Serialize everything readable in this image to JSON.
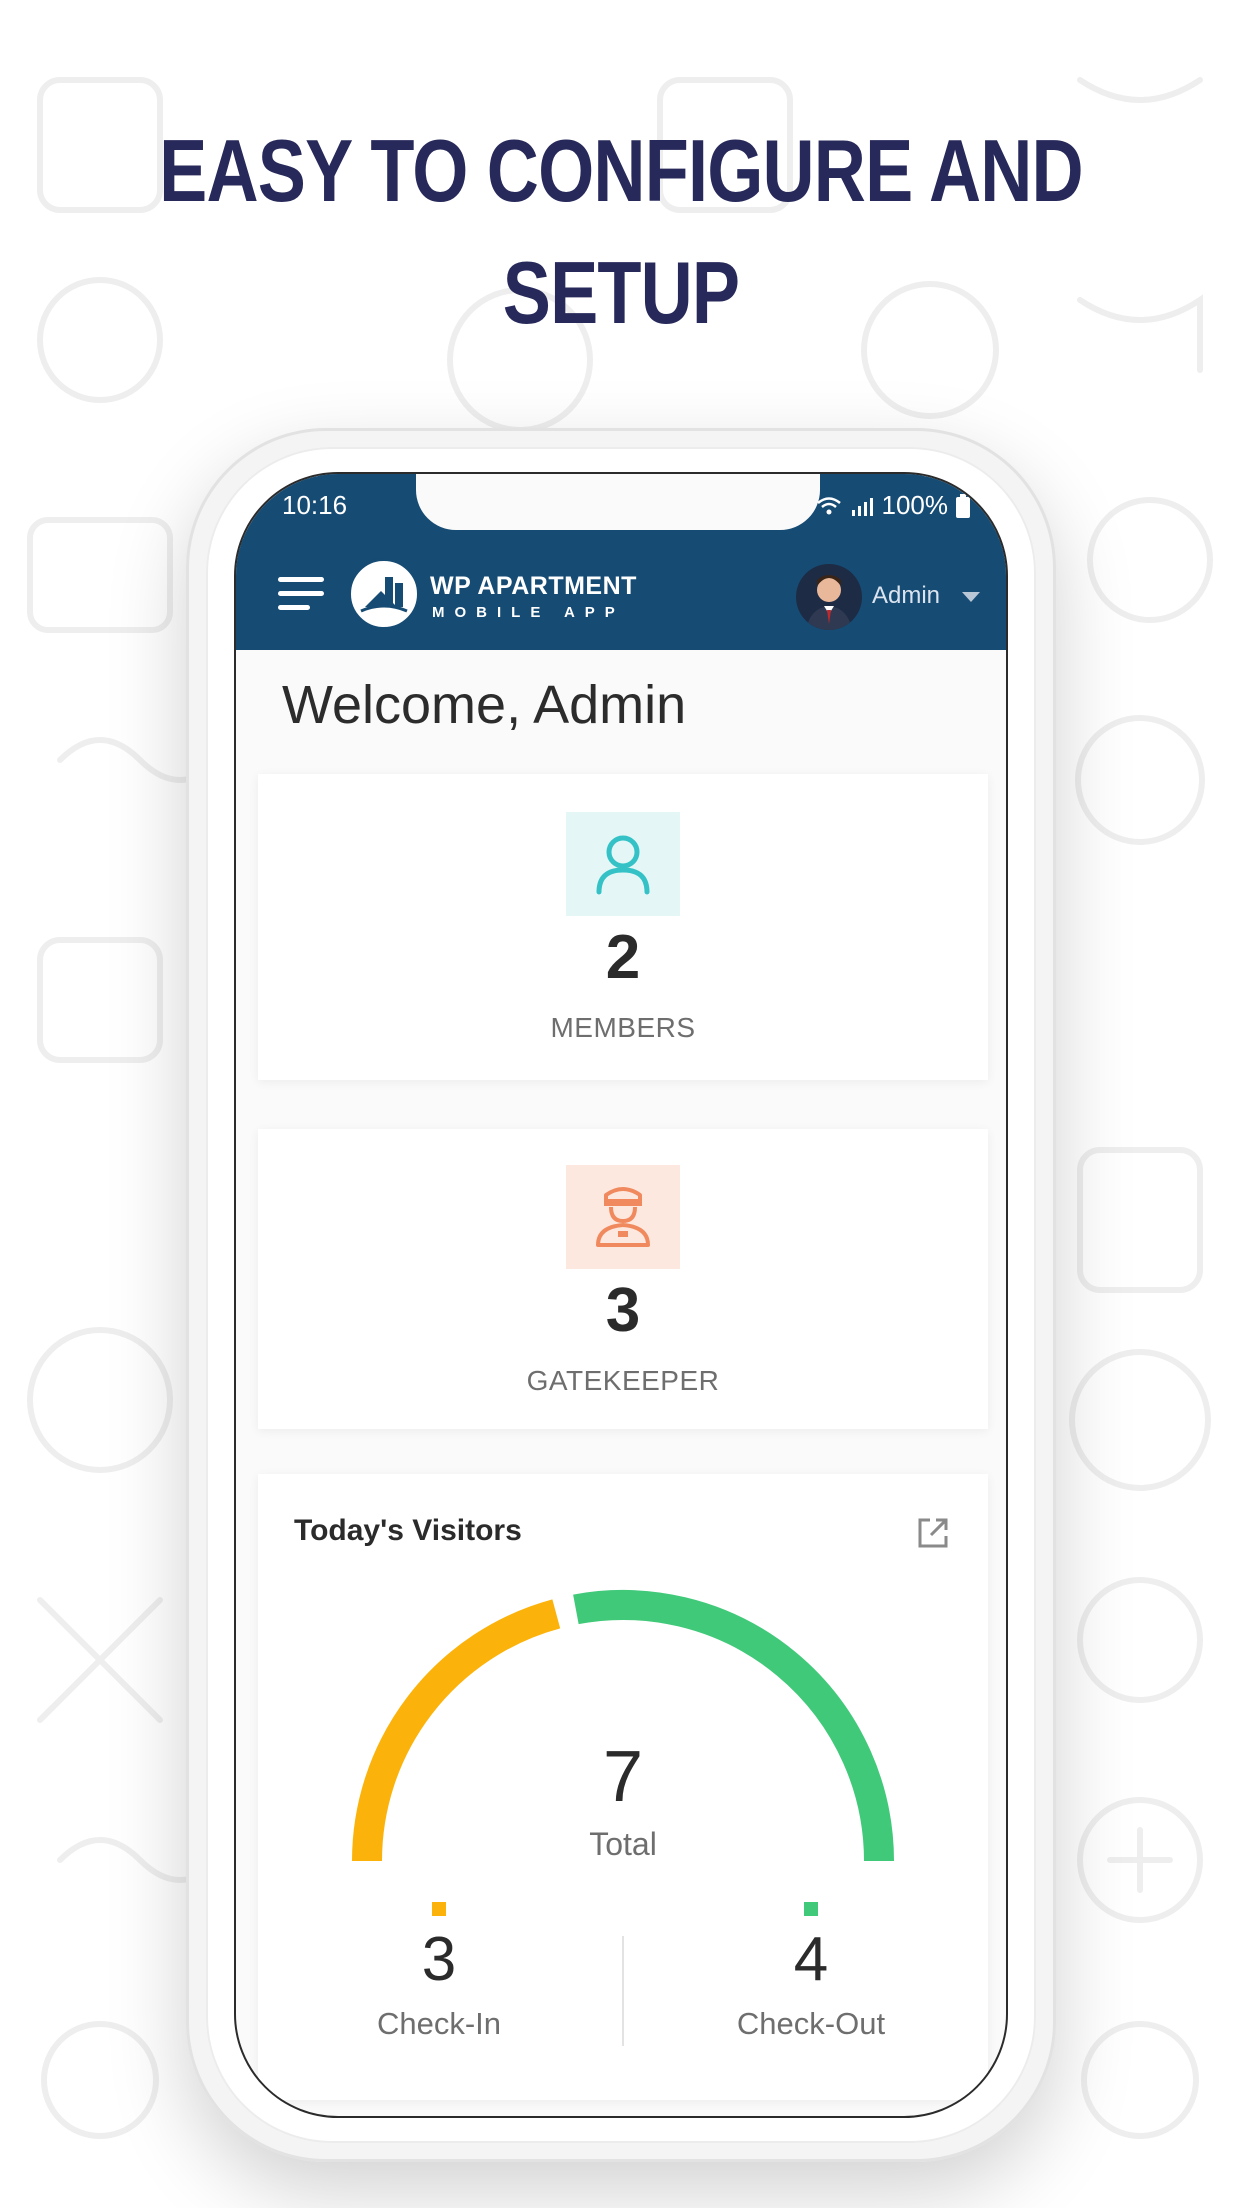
{
  "headline": {
    "line1": "EASY TO CONFIGURE AND",
    "line2": "SETUP"
  },
  "status_bar": {
    "time": "10:16",
    "battery": "100%"
  },
  "app_header": {
    "brand_title": "WP APARTMENT",
    "brand_subtitle": "MOBILE APP",
    "user_name": "Admin"
  },
  "welcome": "Welcome, Admin",
  "members": {
    "value": "2",
    "label": "MEMBERS",
    "icon": "person-icon",
    "tile_color": "#e5f6f7",
    "icon_color": "#35c2c6"
  },
  "gatekeeper": {
    "value": "3",
    "label": "GATEKEEPER",
    "icon": "guard-icon",
    "tile_color": "#fde8e0",
    "icon_color": "#f08a5e"
  },
  "visitors": {
    "title": "Today's Visitors",
    "total": "7",
    "total_label": "Total",
    "checkin": {
      "value": "3",
      "label": "Check-In",
      "color": "#fbb30b"
    },
    "checkout": {
      "value": "4",
      "label": "Check-Out",
      "color": "#41c97a"
    }
  },
  "colors": {
    "header_bg": "#164b74",
    "headline": "#27295a"
  }
}
